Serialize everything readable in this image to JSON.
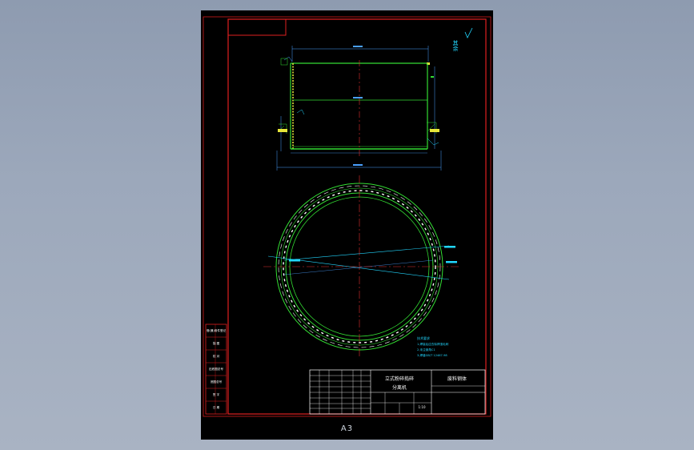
{
  "sheet": {
    "paper_size": "A3",
    "title_block": {
      "part_name_line1": "立式粉碎捣碎",
      "part_name_line2": "分离机",
      "material_label": "废料钢体",
      "scale": "1:10"
    },
    "side_stamp_labels": [
      "借(通)用件登记",
      "描  图",
      "校  对",
      "旧底图总号",
      "底图总号",
      "签  字",
      "日  期"
    ],
    "surface_roughness_label": "其余",
    "tech_notes": [
      "技术要求",
      "1.焊接后应去除焊渣毛刺",
      "2.未注倒角C1",
      "3.焊缝GB/T 12467-98"
    ]
  },
  "colors": {
    "border": "#d21c1c",
    "outline": "#33dd33",
    "hidden": "#ffffff",
    "centerline": "#e03030",
    "dimension": "#4aa0ff",
    "annotation": "#22d7ff",
    "weld": "#e6e63a"
  }
}
